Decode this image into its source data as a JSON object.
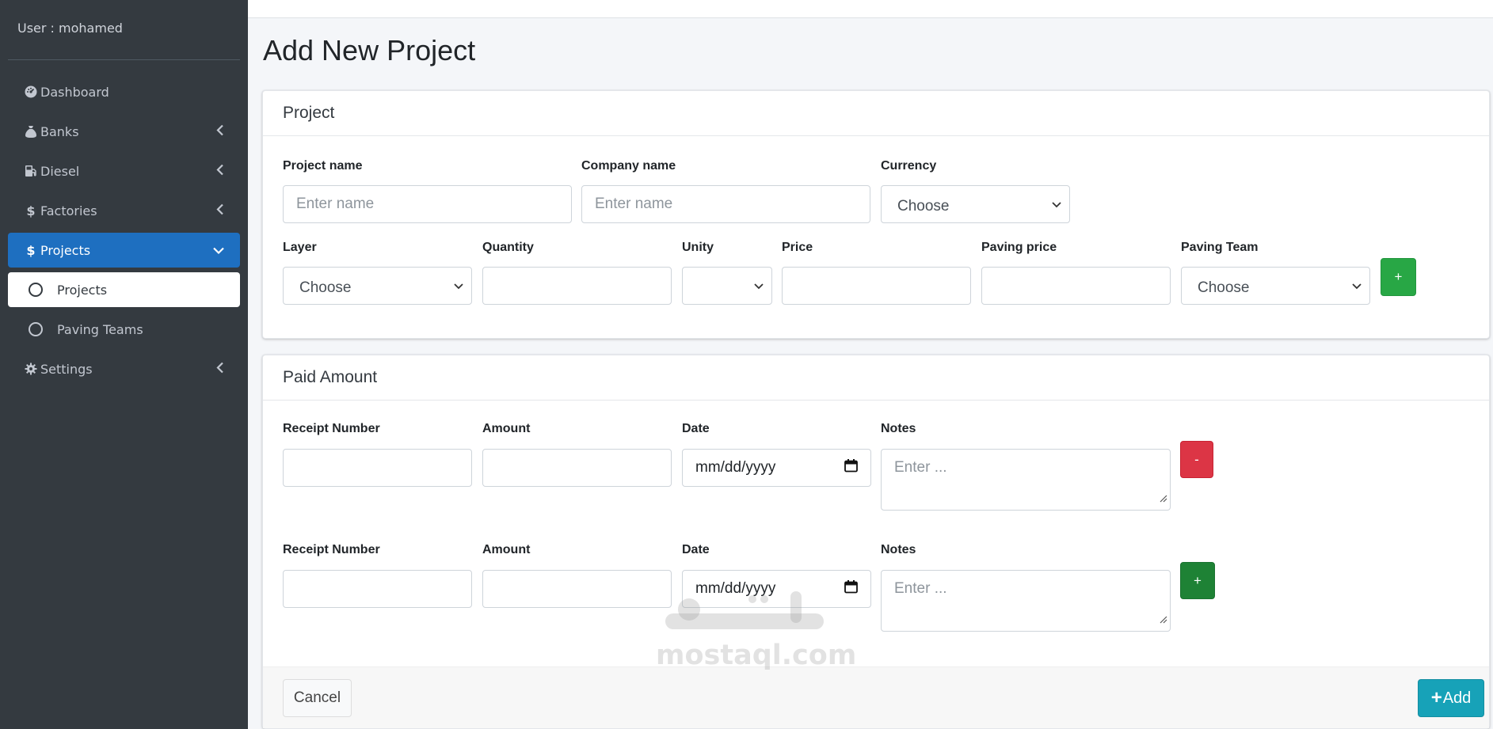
{
  "sidebar": {
    "user_label": "User : mohamed",
    "items": [
      {
        "label": "Dashboard",
        "icon": "tachometer-icon"
      },
      {
        "label": "Banks",
        "icon": "money-bag-icon"
      },
      {
        "label": "Diesel",
        "icon": "gas-pump-icon"
      },
      {
        "label": "Factories",
        "icon": "dollar-icon"
      },
      {
        "label": "Projects",
        "icon": "dollar-icon"
      },
      {
        "label": "Settings",
        "icon": "gear-icon"
      }
    ],
    "sub_items": [
      {
        "label": "Projects"
      },
      {
        "label": "Paving Teams"
      }
    ]
  },
  "page": {
    "title": "Add New Project"
  },
  "project_card": {
    "header": "Project",
    "project_name": {
      "label": "Project name",
      "placeholder": "Enter name"
    },
    "company_name": {
      "label": "Company name",
      "placeholder": "Enter name"
    },
    "currency": {
      "label": "Currency",
      "value": "Choose"
    },
    "layer": {
      "label": "Layer",
      "value": "Choose"
    },
    "quantity": {
      "label": "Quantity",
      "value": ""
    },
    "unity": {
      "label": "Unity",
      "value": ""
    },
    "price": {
      "label": "Price",
      "value": ""
    },
    "paving_price": {
      "label": "Paving price",
      "value": ""
    },
    "paving_team": {
      "label": "Paving Team",
      "value": "Choose"
    },
    "add_row_label": "+"
  },
  "paid_card": {
    "header": "Paid Amount",
    "rows": [
      {
        "receipt_label": "Receipt Number",
        "amount_label": "Amount",
        "date_label": "Date",
        "date_value": "mm/dd/yyyy",
        "notes_label": "Notes",
        "notes_placeholder": "Enter ...",
        "action_label": "-"
      },
      {
        "receipt_label": "Receipt Number",
        "amount_label": "Amount",
        "date_label": "Date",
        "date_value": "mm/dd/yyyy",
        "notes_label": "Notes",
        "notes_placeholder": "Enter ...",
        "action_label": "+"
      }
    ],
    "cancel_label": "Cancel",
    "add_label": "Add"
  },
  "watermark": {
    "text": "mostaql.com"
  },
  "colors": {
    "sidebar": "#343a40",
    "active": "#1e6fc0",
    "green": "#28a745",
    "red": "#dc3545",
    "info": "#17a2b8"
  }
}
